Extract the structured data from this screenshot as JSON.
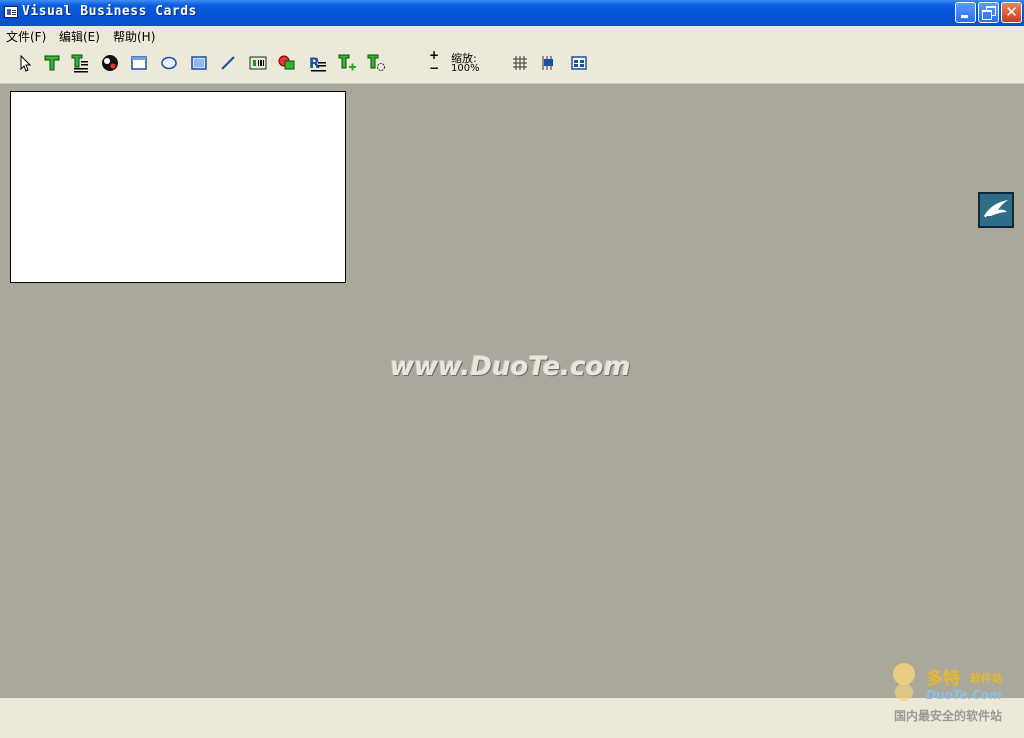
{
  "window": {
    "title": "Visual Business Cards"
  },
  "menu": {
    "items": [
      {
        "label": "文件(F)"
      },
      {
        "label": "编辑(E)"
      },
      {
        "label": "帮助(H)"
      }
    ]
  },
  "toolbar": {
    "tools": [
      {
        "icon": "pointer-icon"
      },
      {
        "icon": "text-icon"
      },
      {
        "icon": "multiline-text-icon"
      },
      {
        "icon": "image-icon"
      },
      {
        "icon": "rectangle-icon"
      },
      {
        "icon": "ellipse-icon"
      },
      {
        "icon": "filled-rectangle-icon"
      },
      {
        "icon": "line-icon"
      },
      {
        "icon": "barcode-icon"
      },
      {
        "icon": "shapes-icon"
      },
      {
        "icon": "rich-text-icon"
      },
      {
        "icon": "add-text-icon"
      },
      {
        "icon": "rotate-text-icon"
      }
    ],
    "zoom": {
      "label": "缩放:",
      "value": "100%",
      "plus": "+",
      "minus": "−"
    },
    "view_tools": [
      {
        "icon": "grid-icon"
      },
      {
        "icon": "align-icon"
      },
      {
        "icon": "layout-icon"
      }
    ]
  },
  "workspace": {
    "watermark": "www.DuoTe.com"
  },
  "branding": {
    "brand": "多特",
    "sub": "软件站",
    "url": "DuoTe.Com",
    "tagline": "国内最安全的软件站"
  },
  "colors": {
    "titlebar": "#0552d6",
    "workspace": "#aaa79b",
    "chrome": "#ece9d8"
  }
}
